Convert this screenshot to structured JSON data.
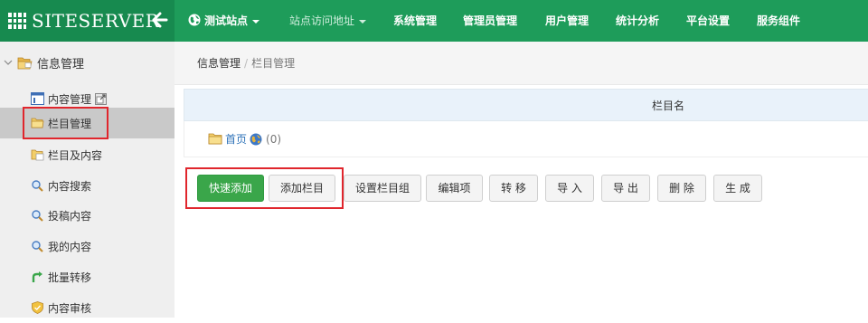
{
  "brand": {
    "name": "SITESERVER"
  },
  "nav": {
    "items": [
      {
        "label": "测试站点",
        "caret": true,
        "icon": "globe-icon"
      },
      {
        "label": "站点访问地址",
        "caret": true,
        "muted": true
      },
      {
        "label": "系统管理"
      },
      {
        "label": "管理员管理"
      },
      {
        "label": "用户管理"
      },
      {
        "label": "统计分析"
      },
      {
        "label": "平台设置"
      },
      {
        "label": "服务组件"
      }
    ]
  },
  "sidebar": {
    "root": {
      "label": "信息管理",
      "icon": "folder-open-icon"
    },
    "items": [
      {
        "label": "内容管理",
        "icon": "content-list-icon",
        "extra_icon": "external-link-icon"
      },
      {
        "label": "栏目管理",
        "icon": "folder-icon",
        "active": true
      },
      {
        "label": "栏目及内容",
        "icon": "folder-content-icon"
      },
      {
        "label": "内容搜索",
        "icon": "magnifier-icon"
      },
      {
        "label": "投稿内容",
        "icon": "magnifier-icon"
      },
      {
        "label": "我的内容",
        "icon": "magnifier-icon"
      },
      {
        "label": "批量转移",
        "icon": "green-arrow-icon"
      },
      {
        "label": "内容审核",
        "icon": "shield-icon"
      }
    ]
  },
  "breadcrumb": {
    "parent": "信息管理",
    "separator": "/",
    "current": "栏目管理"
  },
  "table": {
    "header": "栏目名",
    "rows": [
      {
        "name": "首页",
        "count": "(0)"
      }
    ]
  },
  "actions": {
    "quick_add": "快速添加",
    "add_channel": "添加栏目",
    "set_group": "设置栏目组",
    "edit_items": "编辑项",
    "transfer": "转 移",
    "import": "导 入",
    "export": "导 出",
    "delete": "删 除",
    "generate": "生 成"
  },
  "colors": {
    "nav_bg": "#1e9c5a",
    "brand_bg": "#178a4f",
    "primary_btn": "#3aa64a",
    "highlight": "#e0262d",
    "link": "#2f73b9"
  }
}
